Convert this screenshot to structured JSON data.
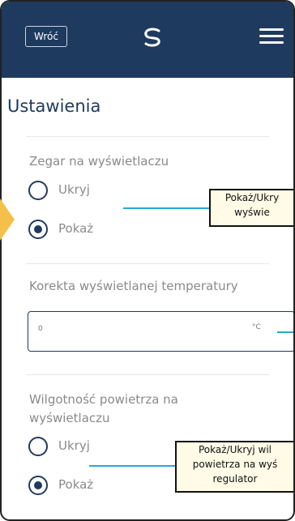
{
  "header": {
    "back_label": "Wróć",
    "logo": "swirl-logo",
    "menu": "hamburger-icon",
    "bg_color": "#1f3a5f"
  },
  "page_title": "Ustawienia",
  "clock_section": {
    "label": "Zegar na wyświetlaczu",
    "options": [
      {
        "label": "Ukryj",
        "selected": false
      },
      {
        "label": "Pokaż",
        "selected": true
      }
    ],
    "callout": [
      "Pokaż/Ukry",
      "wyświe"
    ]
  },
  "temp_section": {
    "label": "Korekta wyświetlanej temperatury",
    "value": "0",
    "unit": "°C"
  },
  "humidity_section": {
    "label_line1": "Wilgotność powietrza na",
    "label_line2": "wyświetlaczu",
    "options": [
      {
        "label": "Ukryj",
        "selected": false
      },
      {
        "label": "Pokaż",
        "selected": true
      }
    ],
    "callout": [
      "Pokaż/Ukryj wil",
      "powietrza na wyś",
      "regulator"
    ]
  },
  "colors": {
    "primary": "#1f3a5f",
    "callout_line": "#2aa7d9",
    "marker": "#f5c04a"
  }
}
